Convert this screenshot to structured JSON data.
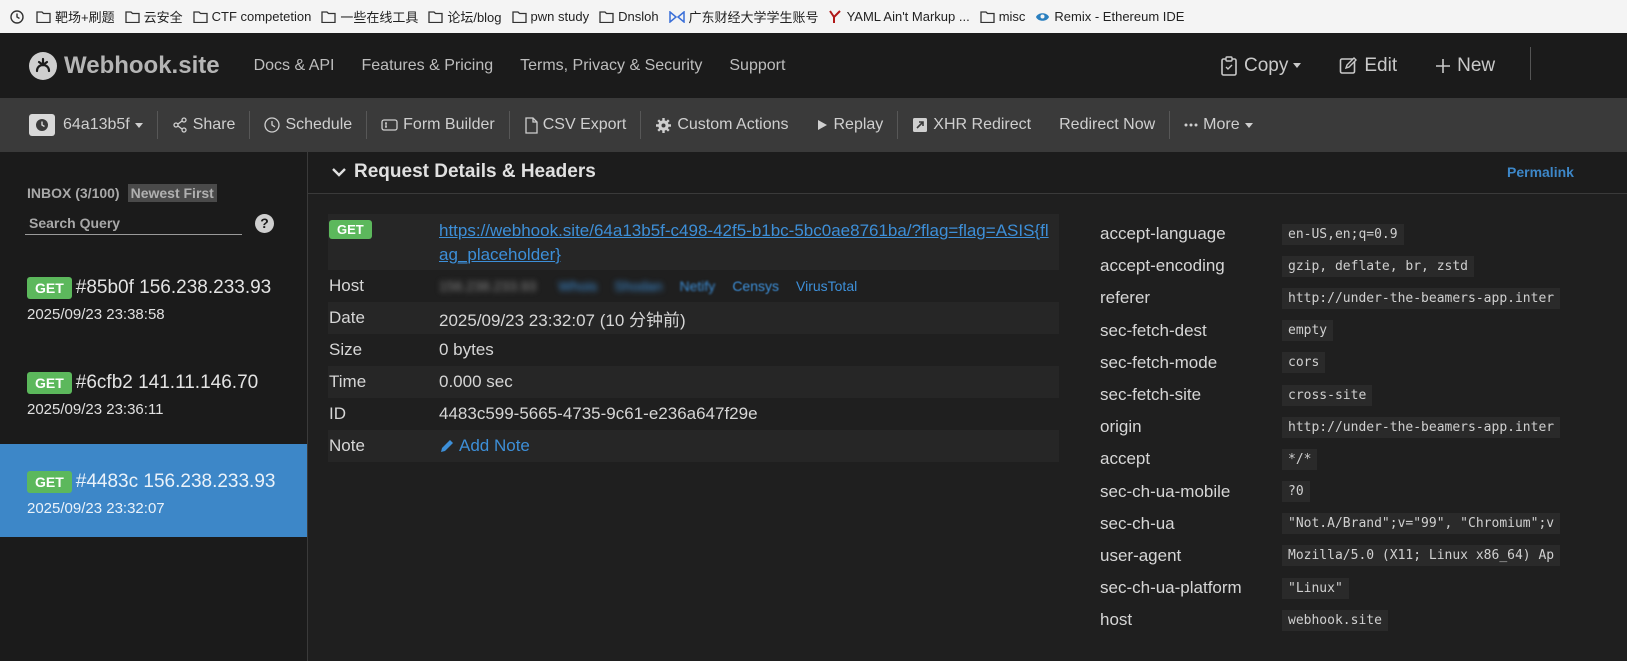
{
  "bookmarks": [
    {
      "label": "靶场+刷题",
      "icon": "folder-icon"
    },
    {
      "label": "云安全",
      "icon": "folder-icon"
    },
    {
      "label": "CTF competetion",
      "icon": "folder-icon"
    },
    {
      "label": "一些在线工具",
      "icon": "folder-icon"
    },
    {
      "label": "论坛/blog",
      "icon": "folder-icon"
    },
    {
      "label": "pwn study",
      "icon": "folder-icon"
    },
    {
      "label": "Dnsloh",
      "icon": "folder-icon"
    },
    {
      "label": "广东财经大学学生账号",
      "icon": "bowtie-icon"
    },
    {
      "label": "YAML Ain't Markup ...",
      "icon": "yaml-icon"
    },
    {
      "label": "misc",
      "icon": "folder-icon"
    },
    {
      "label": "Remix - Ethereum IDE",
      "icon": "remix-icon"
    }
  ],
  "header": {
    "logo_text": "Webhook.site",
    "nav": [
      "Docs & API",
      "Features & Pricing",
      "Terms, Privacy & Security",
      "Support"
    ],
    "copy_label": "Copy",
    "edit_label": "Edit",
    "new_label": "New"
  },
  "toolbar": {
    "token_label": "64a13b5f",
    "share": "Share",
    "schedule": "Schedule",
    "form_builder": "Form Builder",
    "csv_export": "CSV Export",
    "custom_actions": "Custom Actions",
    "replay": "Replay",
    "xhr_redirect": "XHR Redirect",
    "redirect_now": "Redirect Now",
    "more": "More"
  },
  "sidebar": {
    "inbox_label": "INBOX (3/100)",
    "sort_label": "Newest First",
    "search_placeholder": "Search Query",
    "help": "?",
    "requests": [
      {
        "method": "GET",
        "id_ip": "#85b0f 156.238.233.93",
        "time": "2025/09/23 23:38:58"
      },
      {
        "method": "GET",
        "id_ip": "#6cfb2 141.11.146.70",
        "time": "2025/09/23 23:36:11"
      },
      {
        "method": "GET",
        "id_ip": "#4483c 156.238.233.93",
        "time": "2025/09/23 23:32:07"
      }
    ]
  },
  "main": {
    "section_title": "Request Details & Headers",
    "permalink": "Permalink",
    "details": {
      "method": "GET",
      "url": "https://webhook.site/64a13b5f-c498-42f5-b1bc-5bc0ae8761ba/?flag=flag=ASIS{flag_placeholder}",
      "host_label": "Host",
      "host_value": "156.238.233.93",
      "host_links": [
        "Whois",
        "Shodan",
        "Netify",
        "Censys",
        "VirusTotal"
      ],
      "date_label": "Date",
      "date_value": "2025/09/23 23:32:07 (10 分钟前)",
      "size_label": "Size",
      "size_value": "0 bytes",
      "time_label": "Time",
      "time_value": "0.000 sec",
      "id_label": "ID",
      "id_value": "4483c599-5665-4735-9c61-e236a647f29e",
      "note_label": "Note",
      "note_link": "Add Note"
    },
    "headers": [
      {
        "key": "accept-language",
        "value": "en-US,en;q=0.9"
      },
      {
        "key": "accept-encoding",
        "value": "gzip, deflate, br, zstd"
      },
      {
        "key": "referer",
        "value": "http://under-the-beamers-app.inter"
      },
      {
        "key": "sec-fetch-dest",
        "value": "empty"
      },
      {
        "key": "sec-fetch-mode",
        "value": "cors"
      },
      {
        "key": "sec-fetch-site",
        "value": "cross-site"
      },
      {
        "key": "origin",
        "value": "http://under-the-beamers-app.inter"
      },
      {
        "key": "accept",
        "value": "*/*"
      },
      {
        "key": "sec-ch-ua-mobile",
        "value": "?0"
      },
      {
        "key": "sec-ch-ua",
        "value": "\"Not.A/Brand\";v=\"99\", \"Chromium\";v"
      },
      {
        "key": "user-agent",
        "value": "Mozilla/5.0 (X11; Linux x86_64) Ap"
      },
      {
        "key": "sec-ch-ua-platform",
        "value": "\"Linux\""
      },
      {
        "key": "host",
        "value": "webhook.site"
      }
    ]
  }
}
